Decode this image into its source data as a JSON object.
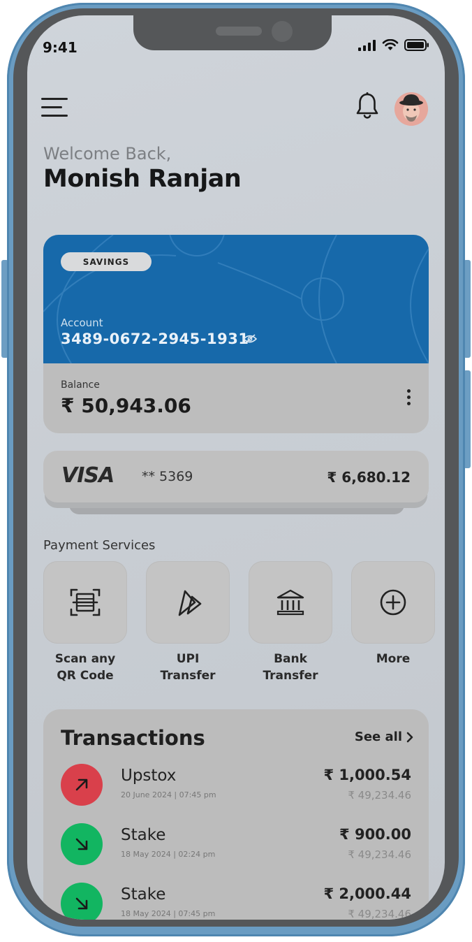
{
  "status_bar": {
    "time": "9:41"
  },
  "header": {
    "welcome": "Welcome Back,",
    "user_name": "Monish Ranjan"
  },
  "account_card": {
    "type_badge": "SAVINGS",
    "account_label": "Account",
    "account_number": "3489-0672-2945-1931",
    "balance_label": "Balance",
    "balance_value": "₹ 50,943.06",
    "color": "#1769aa"
  },
  "visa_card": {
    "brand": "VISA",
    "masked_number": "** 5369",
    "amount": "₹ 6,680.12"
  },
  "payment_services": {
    "title": "Payment Services",
    "items": [
      {
        "label": "Scan any\nQR Code",
        "icon": "qr-scan-icon"
      },
      {
        "label": "UPI\nTransfer",
        "icon": "upi-icon"
      },
      {
        "label": "Bank\nTransfer",
        "icon": "bank-icon"
      },
      {
        "label": "More",
        "icon": "plus-circle-icon"
      }
    ]
  },
  "transactions": {
    "title": "Transactions",
    "see_all": "See all",
    "items": [
      {
        "name": "Upstox",
        "date": "20 June 2024 | 07:45 pm",
        "amount": "₹ 1,000.54",
        "balance": "₹ 49,234.46",
        "direction": "outgoing",
        "color": "#d9404b"
      },
      {
        "name": "Stake",
        "date": "18 May 2024 | 02:24 pm",
        "amount": "₹ 900.00",
        "balance": "₹ 49,234.46",
        "direction": "incoming",
        "color": "#12b561"
      },
      {
        "name": "Stake",
        "date": "18 May 2024 | 07:45 pm",
        "amount": "₹ 2,000.44",
        "balance": "₹ 49,234.46",
        "direction": "incoming",
        "color": "#12b561"
      }
    ]
  }
}
